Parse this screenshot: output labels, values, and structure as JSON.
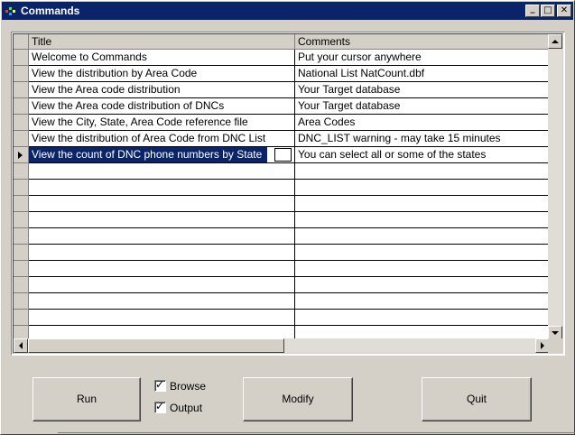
{
  "window": {
    "title": "Commands",
    "controls": {
      "minimize": "_",
      "maximize": "□",
      "close": "✕"
    }
  },
  "grid": {
    "columns": [
      "Title",
      "Comments"
    ],
    "rows": [
      {
        "title": "Welcome to Commands",
        "comment": "Put your cursor anywhere"
      },
      {
        "title": "View the distribution by Area Code",
        "comment": "National List  NatCount.dbf"
      },
      {
        "title": "View the Area code distribution",
        "comment": "Your Target database"
      },
      {
        "title": "View the Area code distribution of DNCs",
        "comment": "Your Target database"
      },
      {
        "title": "View the City, State, Area Code reference file",
        "comment": "Area Codes"
      },
      {
        "title": "View the distribution of Area Code from DNC List",
        "comment": "DNC_LIST warning - may take 15 minutes"
      },
      {
        "title": "View the count of DNC phone numbers by State",
        "comment": "You can select all or some of the states"
      }
    ],
    "active_row": 6
  },
  "buttons": {
    "run": "Run",
    "modify": "Modify",
    "quit": "Quit"
  },
  "options": {
    "browse": {
      "label": "Browse",
      "checked": true
    },
    "output": {
      "label": "Output",
      "checked": true
    }
  },
  "checkmark": "✓"
}
